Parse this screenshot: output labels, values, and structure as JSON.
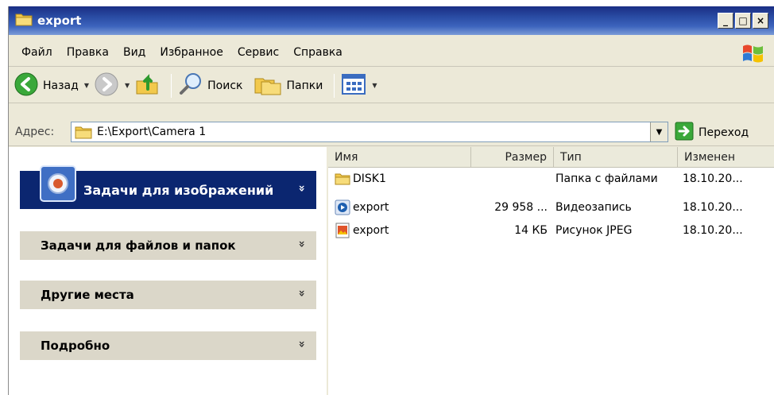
{
  "window": {
    "title": "export"
  },
  "title_buttons": {
    "minimize": "_",
    "maximize": "□",
    "close": "×"
  },
  "menu": [
    "Файл",
    "Правка",
    "Вид",
    "Избранное",
    "Сервис",
    "Справка"
  ],
  "toolbar": {
    "back": "Назад",
    "search": "Поиск",
    "folders": "Папки"
  },
  "address": {
    "label": "Адрес:",
    "path": "E:\\Export\\Camera 1",
    "go": "Переход"
  },
  "tasks": {
    "active": "Задачи для изображений",
    "items": [
      "Задачи для файлов и папок",
      "Другие места",
      "Подробно"
    ],
    "chevron": "»"
  },
  "columns": [
    "Имя",
    "Размер",
    "Тип",
    "Изменен"
  ],
  "files": [
    {
      "icon": "folder-icon",
      "name": "DISK1",
      "size": "",
      "type": "Папка с файлами",
      "modified": "18.10.20..."
    },
    {
      "icon": "video-file-icon",
      "name": "export",
      "size": "29 958 ...",
      "type": "Видеозапись",
      "modified": "18.10.20..."
    },
    {
      "icon": "jpeg-file-icon",
      "name": "export",
      "size": "14 КБ",
      "type": "Рисунок JPEG",
      "modified": "18.10.20..."
    }
  ],
  "colors": {
    "title_bar": "#2b4ea6",
    "task_active": "#0b2670",
    "task_header": "#dbd7c9",
    "window_bg": "#ece9d8"
  }
}
